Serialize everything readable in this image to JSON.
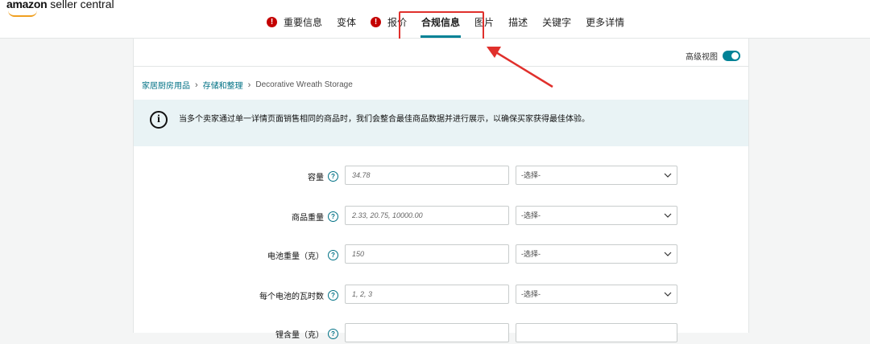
{
  "app": {
    "logo_brand": "amazon",
    "logo_product": "seller central"
  },
  "tabs": [
    {
      "label": "重要信息",
      "warning": true
    },
    {
      "label": "变体",
      "warning": false
    },
    {
      "label": "报价",
      "warning": true
    },
    {
      "label": "合规信息",
      "active": true
    },
    {
      "label": "图片"
    },
    {
      "label": "描述"
    },
    {
      "label": "关键字"
    },
    {
      "label": "更多详情"
    }
  ],
  "advanced_view_label": "高级视图",
  "breadcrumb": [
    "家居厨房用品",
    "存储和整理",
    "Decorative Wreath Storage"
  ],
  "info_text": "当多个卖家通过单一详情页面销售相同的商品时，我们会整合最佳商品数据并进行展示，以确保买家获得最佳体验。",
  "fields": [
    {
      "label": "容量",
      "placeholder": "34.78",
      "select": "-选择-"
    },
    {
      "label": "商品重量",
      "placeholder": "2.33, 20.75, 10000.00",
      "select": "-选择-"
    },
    {
      "label": "电池重量（克）",
      "placeholder": "150",
      "select": "-选择-"
    },
    {
      "label": "每个电池的瓦时数",
      "placeholder": "1, 2, 3",
      "select": "-选择-"
    },
    {
      "label": "锂含量（克）",
      "placeholder": "",
      "select": ""
    }
  ],
  "colors": {
    "accent": "#008296",
    "highlight": "#e0302c",
    "warning": "#c40000"
  }
}
